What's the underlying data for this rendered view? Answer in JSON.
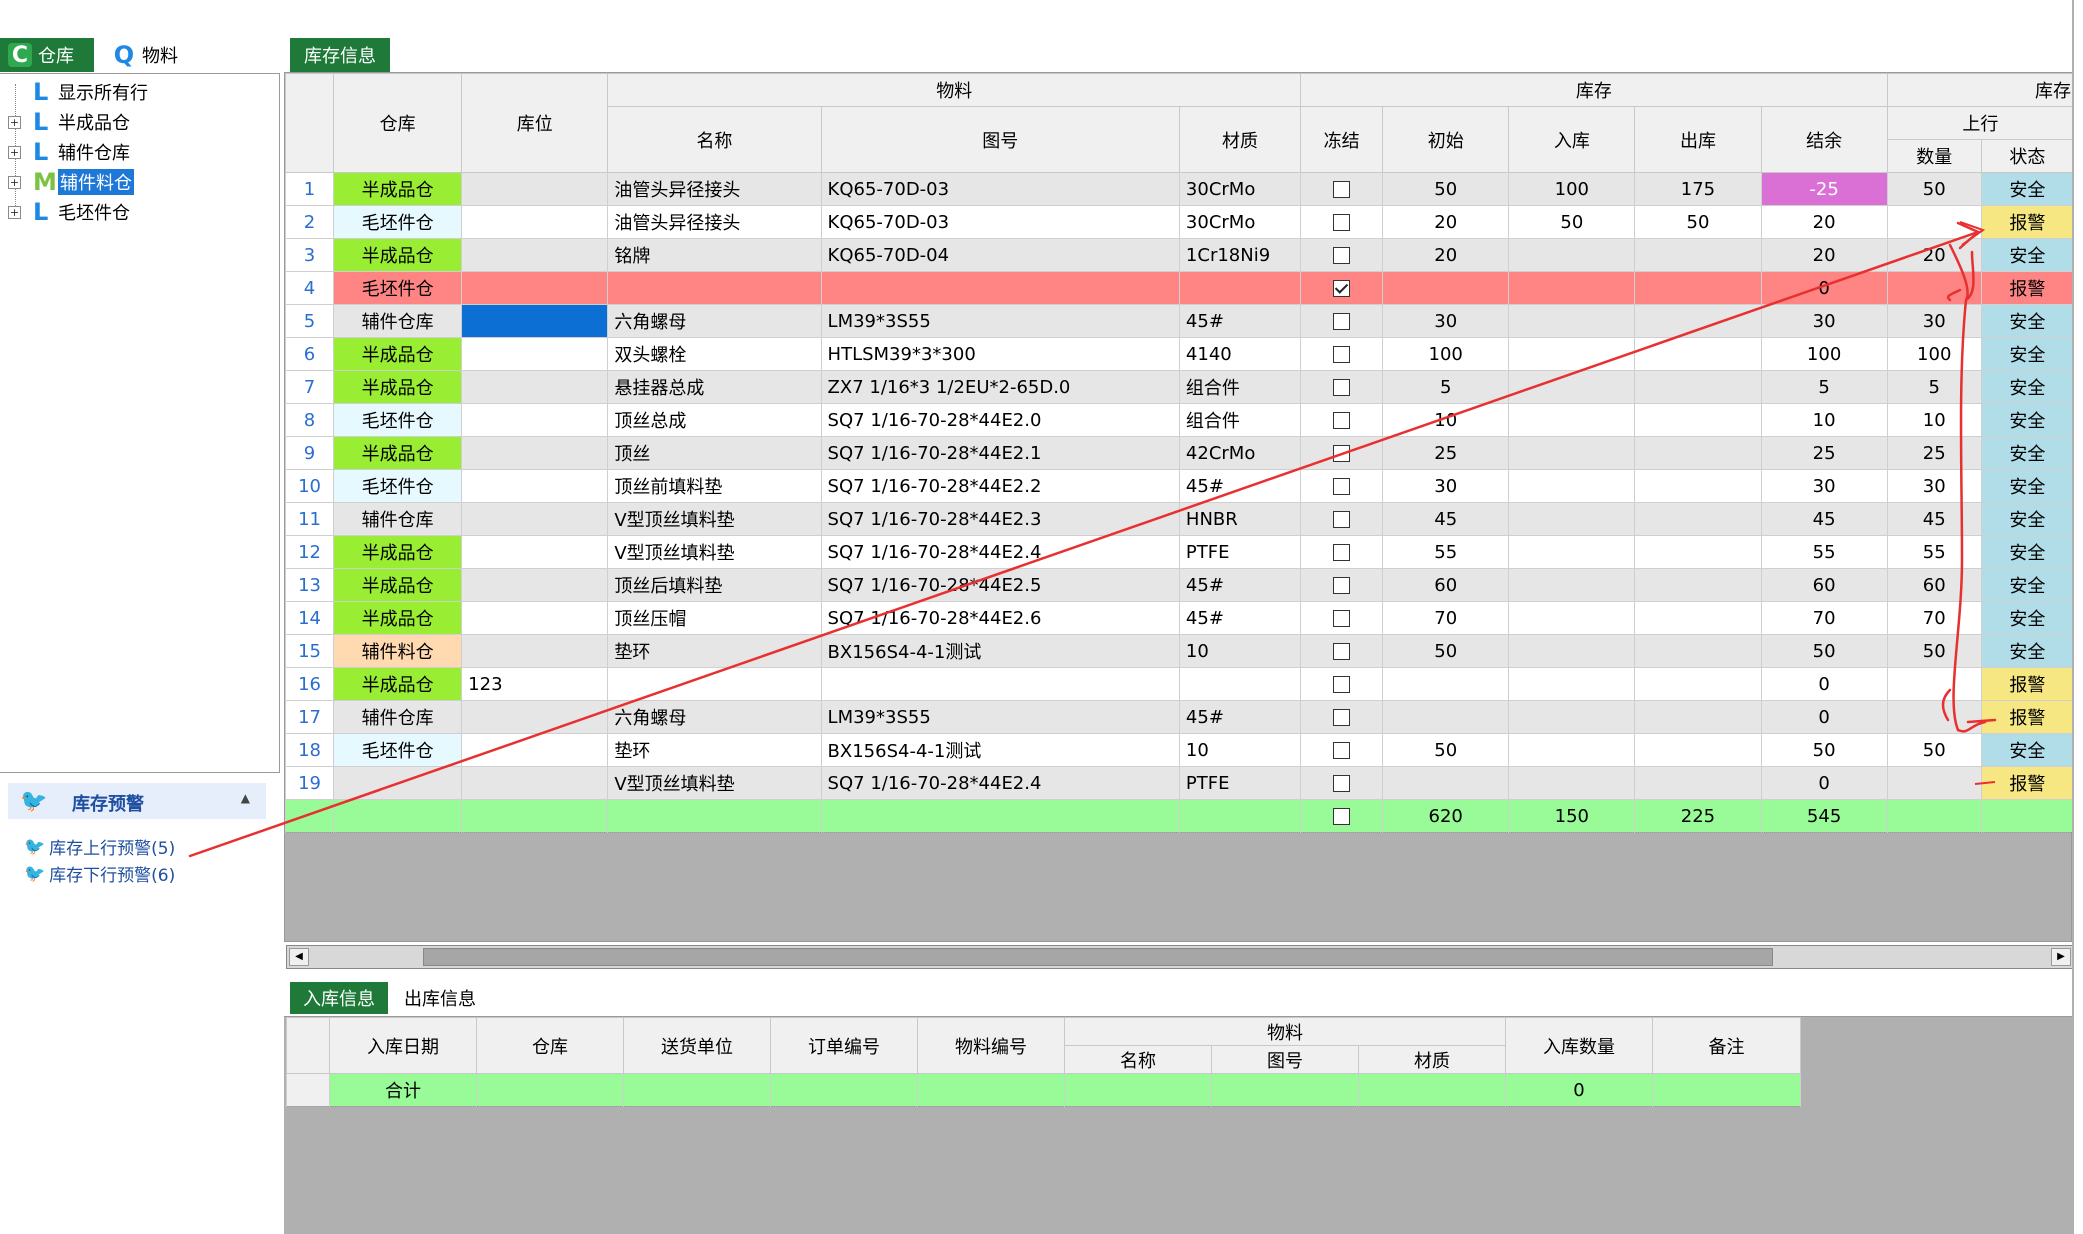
{
  "left_tabs": [
    {
      "label": "仓库",
      "icon": "C"
    },
    {
      "label": "物料",
      "icon": "Q"
    }
  ],
  "tree": {
    "items": [
      {
        "label": "显示所有行",
        "icon": "L",
        "expandable": false
      },
      {
        "label": "半成品仓",
        "icon": "L",
        "expandable": true
      },
      {
        "label": "辅件仓库",
        "icon": "L",
        "expandable": true
      },
      {
        "label": "辅件料仓",
        "icon": "M",
        "expandable": true,
        "selected": true
      },
      {
        "label": "毛坯件仓",
        "icon": "L",
        "expandable": true
      }
    ]
  },
  "warning": {
    "title": "库存预警",
    "links": [
      {
        "label": "库存上行预警(5)"
      },
      {
        "label": "库存下行预警(6)"
      }
    ]
  },
  "main_tab": "库存信息",
  "grid": {
    "group_headers": {
      "material": "物料",
      "stock": "库存",
      "stock2": "库存",
      "upper": "上行"
    },
    "headers": {
      "warehouse": "仓库",
      "location": "库位",
      "name": "名称",
      "drawing": "图号",
      "material": "材质",
      "frozen": "冻结",
      "initial": "初始",
      "inbound": "入库",
      "outbound": "出库",
      "balance": "结余",
      "qty": "数量",
      "status": "状态"
    },
    "rows": [
      {
        "no": "1",
        "wh": "半成品仓",
        "whType": "semi",
        "loc": "",
        "name": "油管头异径接头",
        "drawing": "KQ65-70D-03",
        "mat": "30CrMo",
        "frozen": false,
        "init": "50",
        "in": "100",
        "out": "175",
        "bal": "-25",
        "qty": "50",
        "status": "安全"
      },
      {
        "no": "2",
        "wh": "毛坯件仓",
        "whType": "blank",
        "loc": "",
        "name": "油管头异径接头",
        "drawing": "KQ65-70D-03",
        "mat": "30CrMo",
        "frozen": false,
        "init": "20",
        "in": "50",
        "out": "50",
        "bal": "20",
        "qty": "",
        "status": "报警"
      },
      {
        "no": "3",
        "wh": "半成品仓",
        "whType": "semi",
        "loc": "",
        "name": "铭牌",
        "drawing": "KQ65-70D-04",
        "mat": "1Cr18Ni9",
        "frozen": false,
        "init": "20",
        "in": "",
        "out": "",
        "bal": "20",
        "qty": "20",
        "status": "安全"
      },
      {
        "no": "4",
        "wh": "毛坯件仓",
        "whType": "blank",
        "loc": "",
        "name": "",
        "drawing": "",
        "mat": "",
        "frozen": true,
        "init": "",
        "in": "",
        "out": "",
        "bal": "0",
        "qty": "",
        "status": "报警",
        "red": true
      },
      {
        "no": "5",
        "wh": "辅件仓库",
        "whType": "aux",
        "loc": "",
        "locBlue": true,
        "name": "六角螺母",
        "drawing": "LM39*3S55",
        "mat": "45#",
        "frozen": false,
        "init": "30",
        "in": "",
        "out": "",
        "bal": "30",
        "qty": "30",
        "status": "安全"
      },
      {
        "no": "6",
        "wh": "半成品仓",
        "whType": "semi",
        "loc": "",
        "name": "双头螺栓",
        "drawing": "HTLSM39*3*300",
        "mat": "4140",
        "frozen": false,
        "init": "100",
        "in": "",
        "out": "",
        "bal": "100",
        "qty": "100",
        "status": "安全"
      },
      {
        "no": "7",
        "wh": "半成品仓",
        "whType": "semi",
        "loc": "",
        "name": "悬挂器总成",
        "drawing": "ZX7 1/16*3 1/2EU*2-65D.0",
        "mat": "组合件",
        "frozen": false,
        "init": "5",
        "in": "",
        "out": "",
        "bal": "5",
        "qty": "5",
        "status": "安全"
      },
      {
        "no": "8",
        "wh": "毛坯件仓",
        "whType": "blank",
        "loc": "",
        "name": "顶丝总成",
        "drawing": "SQ7 1/16-70-28*44E2.0",
        "mat": "组合件",
        "frozen": false,
        "init": "10",
        "in": "",
        "out": "",
        "bal": "10",
        "qty": "10",
        "status": "安全"
      },
      {
        "no": "9",
        "wh": "半成品仓",
        "whType": "semi",
        "loc": "",
        "name": "顶丝",
        "drawing": "SQ7 1/16-70-28*44E2.1",
        "mat": "42CrMo",
        "frozen": false,
        "init": "25",
        "in": "",
        "out": "",
        "bal": "25",
        "qty": "25",
        "status": "安全"
      },
      {
        "no": "10",
        "wh": "毛坯件仓",
        "whType": "blank",
        "loc": "",
        "name": "顶丝前填料垫",
        "drawing": "SQ7 1/16-70-28*44E2.2",
        "mat": "45#",
        "frozen": false,
        "init": "30",
        "in": "",
        "out": "",
        "bal": "30",
        "qty": "30",
        "status": "安全"
      },
      {
        "no": "11",
        "wh": "辅件仓库",
        "whType": "aux",
        "loc": "",
        "name": "V型顶丝填料垫",
        "drawing": "SQ7 1/16-70-28*44E2.3",
        "mat": "HNBR",
        "frozen": false,
        "init": "45",
        "in": "",
        "out": "",
        "bal": "45",
        "qty": "45",
        "status": "安全"
      },
      {
        "no": "12",
        "wh": "半成品仓",
        "whType": "semi",
        "loc": "",
        "name": "V型顶丝填料垫",
        "drawing": "SQ7 1/16-70-28*44E2.4",
        "mat": "PTFE",
        "frozen": false,
        "init": "55",
        "in": "",
        "out": "",
        "bal": "55",
        "qty": "55",
        "status": "安全"
      },
      {
        "no": "13",
        "wh": "半成品仓",
        "whType": "semi",
        "loc": "",
        "name": "顶丝后填料垫",
        "drawing": "SQ7 1/16-70-28*44E2.5",
        "mat": "45#",
        "frozen": false,
        "init": "60",
        "in": "",
        "out": "",
        "bal": "60",
        "qty": "60",
        "status": "安全"
      },
      {
        "no": "14",
        "wh": "半成品仓",
        "whType": "semi",
        "loc": "",
        "name": "顶丝压帽",
        "drawing": "SQ7 1/16-70-28*44E2.6",
        "mat": "45#",
        "frozen": false,
        "init": "70",
        "in": "",
        "out": "",
        "bal": "70",
        "qty": "70",
        "status": "安全"
      },
      {
        "no": "15",
        "wh": "辅件料仓",
        "whType": "auxmat",
        "loc": "",
        "name": "垫环",
        "drawing": "BX156S4-4-1测试",
        "mat": "10",
        "frozen": false,
        "init": "50",
        "in": "",
        "out": "",
        "bal": "50",
        "qty": "50",
        "status": "安全"
      },
      {
        "no": "16",
        "wh": "半成品仓",
        "whType": "semi",
        "loc": "123",
        "name": "",
        "drawing": "",
        "mat": "",
        "frozen": false,
        "init": "",
        "in": "",
        "out": "",
        "bal": "0",
        "qty": "",
        "status": "报警"
      },
      {
        "no": "17",
        "wh": "辅件仓库",
        "whType": "aux",
        "loc": "",
        "name": "六角螺母",
        "drawing": "LM39*3S55",
        "mat": "45#",
        "frozen": false,
        "init": "",
        "in": "",
        "out": "",
        "bal": "0",
        "qty": "",
        "status": "报警"
      },
      {
        "no": "18",
        "wh": "毛坯件仓",
        "whType": "blank",
        "loc": "",
        "name": "垫环",
        "drawing": "BX156S4-4-1测试",
        "mat": "10",
        "frozen": false,
        "init": "50",
        "in": "",
        "out": "",
        "bal": "50",
        "qty": "50",
        "status": "安全"
      },
      {
        "no": "19",
        "wh": "",
        "whType": "none",
        "loc": "",
        "name": "V型顶丝填料垫",
        "drawing": "SQ7 1/16-70-28*44E2.4",
        "mat": "PTFE",
        "frozen": false,
        "init": "",
        "in": "",
        "out": "",
        "bal": "0",
        "qty": "",
        "status": "报警"
      }
    ],
    "totals": {
      "init": "620",
      "in": "150",
      "out": "225",
      "bal": "545"
    }
  },
  "bottom_tabs": [
    "入库信息",
    "出库信息"
  ],
  "bottom_grid": {
    "headers": {
      "date": "入库日期",
      "warehouse": "仓库",
      "supplier": "送货单位",
      "order": "订单编号",
      "code": "物料编号",
      "material_group": "物料",
      "name": "名称",
      "drawing": "图号",
      "mat": "材质",
      "qty": "入库数量",
      "note": "备注"
    },
    "total_label": "合计",
    "total_qty": "0"
  },
  "colors": {
    "tab_green": "#1f7a3a",
    "semi_wh": "#99ee33",
    "safe": "#b0dde8",
    "alarm": "#f7e783",
    "negative": "#da70d6",
    "frozen_row": "#ff8585",
    "total_row": "#98fb98",
    "annotation": "#e83030"
  }
}
